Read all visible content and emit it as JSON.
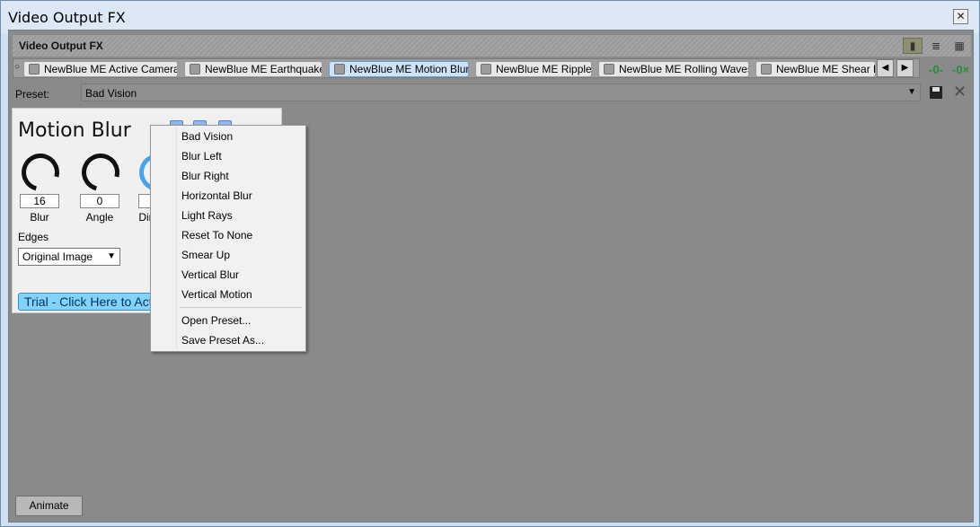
{
  "window": {
    "title": "Video Output FX",
    "close_glyph": "✕"
  },
  "header": {
    "label": "Video Output FX",
    "view_buttons": [
      "▮",
      "≣",
      "▦"
    ]
  },
  "chain": {
    "tabs": [
      {
        "label": "NewBlue ME Active Camera",
        "active": false
      },
      {
        "label": "NewBlue ME Earthquake",
        "active": false
      },
      {
        "label": "NewBlue ME Motion Blur",
        "active": true
      },
      {
        "label": "NewBlue ME Ripple",
        "active": false
      },
      {
        "label": "NewBlue ME Rolling Waves",
        "active": false
      },
      {
        "label": "NewBlue ME Shear Er",
        "active": false
      }
    ],
    "prev_glyph": "◀",
    "next_glyph": "▶"
  },
  "preset": {
    "label": "Preset:",
    "value": "Bad Vision",
    "arrow": "▼"
  },
  "panel": {
    "title": "Motion Blur",
    "knobs": [
      {
        "label": "Blur",
        "value": "16"
      },
      {
        "label": "Angle",
        "value": "0"
      },
      {
        "label": "Dir",
        "value": ""
      }
    ],
    "edges_label": "Edges",
    "edges_value": "Original Image",
    "trial_text": "Trial - Click Here to Acti"
  },
  "animate_label": "Animate",
  "menu": {
    "items": [
      "Bad Vision",
      "Blur Left",
      "Blur Right",
      "Horizontal Blur",
      "Light Rays",
      "Reset To None",
      "Smear Up",
      "Vertical Blur",
      "Vertical Motion"
    ],
    "actions": [
      "Open Preset...",
      "Save Preset As..."
    ]
  },
  "colors": {
    "accent": "#6d9bd1",
    "trial": "#7fd4ff",
    "chain_icon": "#2a8b3b"
  }
}
